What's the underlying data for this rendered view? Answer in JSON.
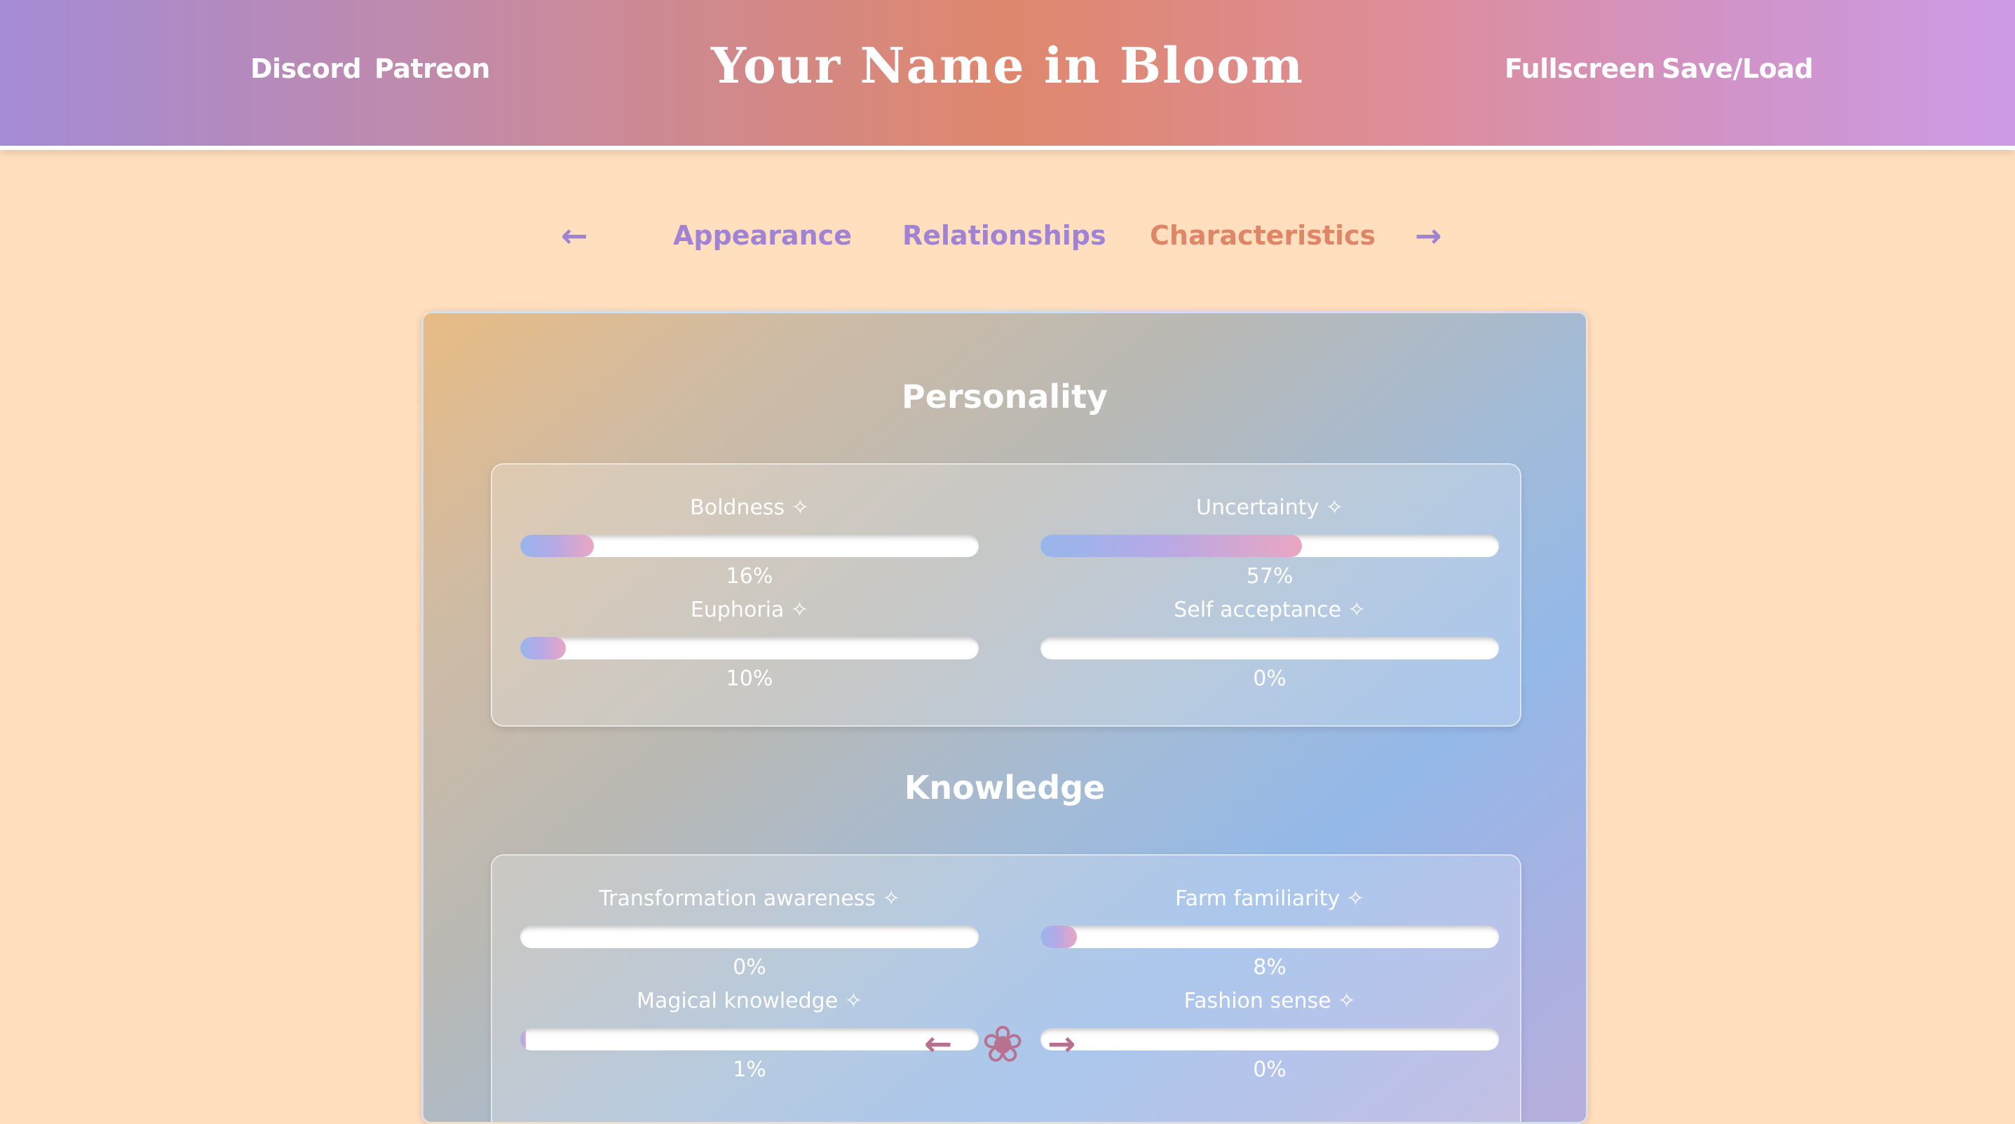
{
  "header": {
    "title": "Your Name in Bloom",
    "left_links": [
      "Discord",
      "Patreon"
    ],
    "right_links": [
      "Fullscreen",
      "Save/Load"
    ]
  },
  "tabs": {
    "prev_arrow": "←",
    "next_arrow": "→",
    "items": [
      {
        "label": "Appearance",
        "active": false
      },
      {
        "label": "Relationships",
        "active": false
      },
      {
        "label": "Characteristics",
        "active": true
      }
    ]
  },
  "sections": [
    {
      "title": "Personality",
      "stats": [
        {
          "label": "Boldness ✧",
          "value": "16%",
          "fill": 0.16
        },
        {
          "label": "Uncertainty ✧",
          "value": "57%",
          "fill": 0.57
        },
        {
          "label": "Euphoria ✧",
          "value": "10%",
          "fill": 0.1
        },
        {
          "label": "Self acceptance ✧",
          "value": "0%",
          "fill": 0.0
        }
      ]
    },
    {
      "title": "Knowledge",
      "stats": [
        {
          "label": "Transformation awareness ✧",
          "value": "0%",
          "fill": 0.0
        },
        {
          "label": "Farm familiarity ✧",
          "value": "8%",
          "fill": 0.08
        },
        {
          "label": "Magical knowledge ✧",
          "value": "1%",
          "fill": 0.01
        },
        {
          "label": "Fashion sense ✧",
          "value": "0%",
          "fill": 0.0
        }
      ]
    }
  ],
  "float_nav": {
    "back": "←",
    "flower": "❀",
    "forward": "→"
  },
  "colors": {
    "accent_purple": "#a083d2",
    "accent_orange": "#df8668",
    "flower_pink": "#b8718f"
  }
}
